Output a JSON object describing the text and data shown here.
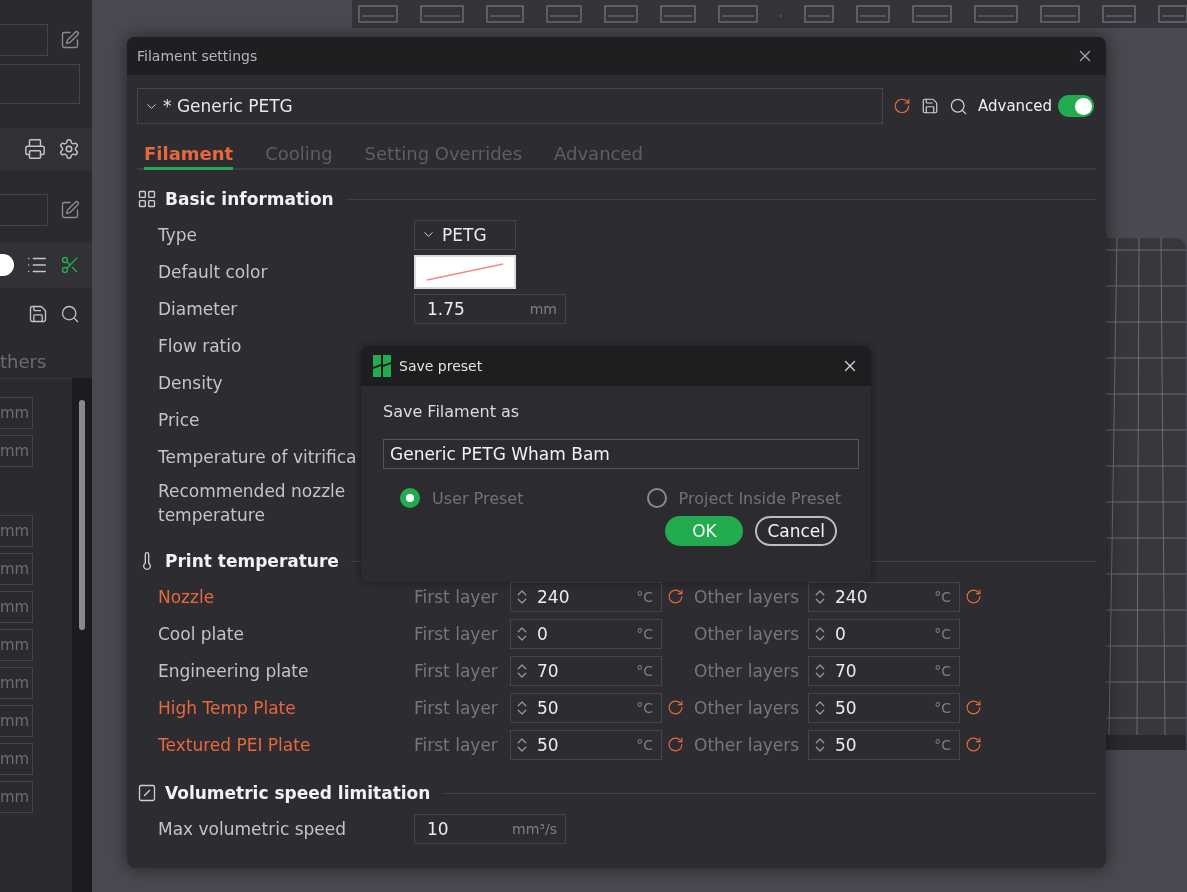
{
  "sidebar": {
    "tab_label": "thers",
    "units": [
      "mm",
      "mm",
      "mm",
      "mm",
      "mm",
      "mm",
      "mm",
      "mm",
      "mm",
      "mm"
    ]
  },
  "dialog": {
    "title": "Filament settings",
    "preset": "* Generic PETG",
    "advanced": {
      "label": "Advanced",
      "on": true
    },
    "tabs": [
      {
        "label": "Filament",
        "selected": true
      },
      {
        "label": "Cooling",
        "selected": false
      },
      {
        "label": "Setting Overrides",
        "selected": false
      },
      {
        "label": "Advanced",
        "selected": false
      }
    ],
    "sections": [
      {
        "title": "Basic information",
        "kind": "grid",
        "rows": [
          {
            "label": "Type",
            "kind": "dropdown",
            "value": "PETG"
          },
          {
            "label": "Default color",
            "kind": "color",
            "color": "#f08a7a"
          },
          {
            "label": "Diameter",
            "kind": "number",
            "value": "1.75",
            "unit": "mm"
          },
          {
            "label": "Flow ratio",
            "kind": "covered"
          },
          {
            "label": "Density",
            "kind": "covered"
          },
          {
            "label": "Price",
            "kind": "covered"
          },
          {
            "label": "Temperature of vitrifica",
            "kind": "covered"
          },
          {
            "label": "Recommended nozzle temperature",
            "kind": "covered"
          }
        ]
      },
      {
        "title": "Print temperature",
        "kind": "thermometer",
        "rows": [
          {
            "label": "Nozzle",
            "kind": "temperature",
            "modified": true,
            "first_label": "First layer",
            "first": "240",
            "first_unit": "°C",
            "other_label": "Other layers",
            "other": "240",
            "other_unit": "°C"
          },
          {
            "label": "Cool plate",
            "kind": "temperature",
            "modified": false,
            "first_label": "First layer",
            "first": "0",
            "first_unit": "°C",
            "other_label": "Other layers",
            "other": "0",
            "other_unit": "°C"
          },
          {
            "label": "Engineering plate",
            "kind": "temperature",
            "modified": false,
            "first_label": "First layer",
            "first": "70",
            "first_unit": "°C",
            "other_label": "Other layers",
            "other": "70",
            "other_unit": "°C"
          },
          {
            "label": "High Temp Plate",
            "kind": "temperature",
            "modified": true,
            "first_label": "First layer",
            "first": "50",
            "first_unit": "°C",
            "other_label": "Other layers",
            "other": "50",
            "other_unit": "°C"
          },
          {
            "label": "Textured PEI Plate",
            "kind": "temperature",
            "modified": true,
            "first_label": "First layer",
            "first": "50",
            "first_unit": "°C",
            "other_label": "Other layers",
            "other": "50",
            "other_unit": "°C"
          }
        ]
      },
      {
        "title": "Volumetric speed limitation",
        "kind": "speed",
        "rows": [
          {
            "label": "Max volumetric speed",
            "kind": "number",
            "value": "10",
            "unit": "mm³/s"
          }
        ]
      }
    ]
  },
  "modal": {
    "title": "Save preset",
    "prompt": "Save Filament as",
    "name": "Generic PETG Wham Bam",
    "options": [
      {
        "label": "User Preset",
        "selected": true
      },
      {
        "label": "Project Inside Preset",
        "selected": false
      }
    ],
    "buttons": [
      {
        "label": "OK",
        "kind": "primary"
      },
      {
        "label": "Cancel",
        "kind": "secondary"
      }
    ]
  }
}
